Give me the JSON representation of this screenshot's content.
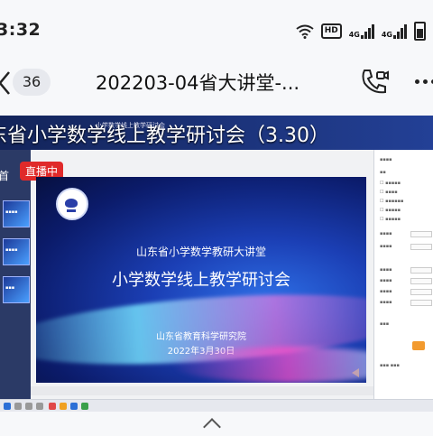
{
  "status_bar": {
    "time": "3:32",
    "hd": "HD",
    "sim1": "4G",
    "sim2": "4G"
  },
  "app_header": {
    "badge_count": "36",
    "title": "202203-04省大讲堂-..."
  },
  "stream": {
    "banner_title": "东省小学数学线上教学研讨会（3.30）",
    "window_caption": "小学数学线上教学研讨会",
    "side_label": "首",
    "live_label": "直播中",
    "slide": {
      "line1": "山东省小学数学教研大讲堂",
      "line2": "小学数学线上教学研讨会",
      "line3": "山东省教育科学研究院",
      "line4": "2022年3月30日"
    }
  },
  "colors": {
    "live_red": "#e02a2a",
    "slide_blue": "#1b3fb5"
  }
}
